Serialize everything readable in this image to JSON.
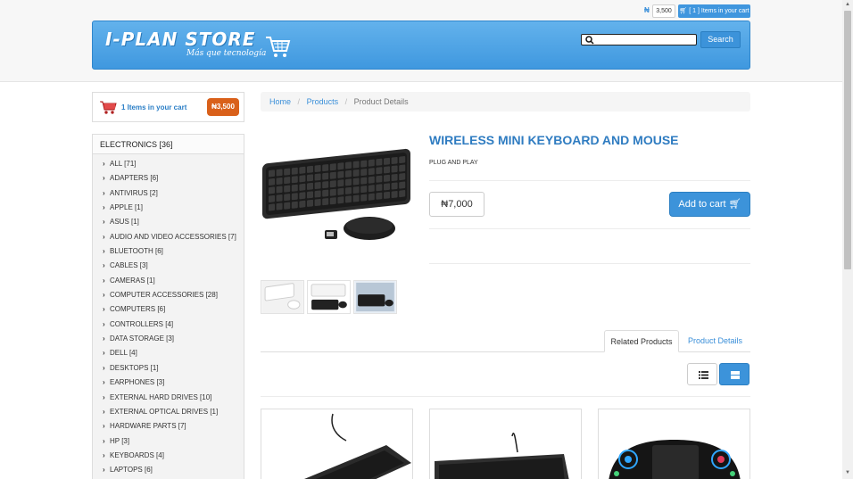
{
  "topbar": {
    "currency_symbol": "₦",
    "amount": "3,500",
    "cart_label": "[ 1 ] Items in your cart"
  },
  "header": {
    "logo_text": "I-PLAN STORE",
    "tagline": "Más que tecnología",
    "search_button": "Search"
  },
  "cart_summary": {
    "text": "1 Items in your cart",
    "badge": "₦3,500"
  },
  "categories": {
    "title": "ELECTRONICS [36]",
    "items": [
      "ALL [71]",
      "ADAPTERS [6]",
      "ANTIVIRUS [2]",
      "APPLE [1]",
      "ASUS [1]",
      "AUDIO AND VIDEO ACCESSORIES [7]",
      "BLUETOOTH [6]",
      "CABLES [3]",
      "CAMERAS [1]",
      "COMPUTER ACCESSORIES [28]",
      "COMPUTERS [6]",
      "CONTROLLERS [4]",
      "DATA STORAGE [3]",
      "DELL [4]",
      "DESKTOPS [1]",
      "EARPHONES [3]",
      "EXTERNAL HARD DRIVES [10]",
      "EXTERNAL OPTICAL DRIVES [1]",
      "HARDWARE PARTS [7]",
      "HP [3]",
      "KEYBOARDS [4]",
      "LAPTOPS [6]"
    ]
  },
  "breadcrumb": {
    "home": "Home",
    "products": "Products",
    "current": "Product Details"
  },
  "product": {
    "title": "WIRELESS MINI KEYBOARD AND MOUSE",
    "subtitle": "PLUG AND PLAY",
    "price": "₦7,000",
    "add_to_cart": "Add to cart"
  },
  "tabs": {
    "related": "Related Products",
    "details": "Product Details"
  },
  "colors": {
    "brand_blue": "#3c93da",
    "badge_orange": "#d9601a",
    "link_blue": "#3a8fd9"
  }
}
